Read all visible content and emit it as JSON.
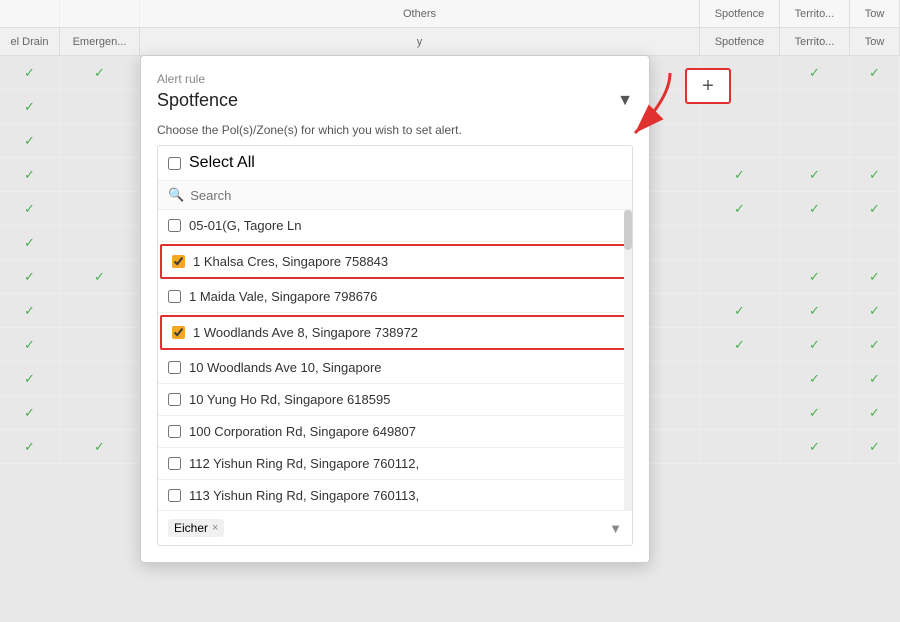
{
  "header": {
    "others_label": "Others",
    "col_spotfence": "Spotfence",
    "col_territo": "Territo...",
    "col_tow": "Tow"
  },
  "subheader": {
    "col_el_drain": "el Drain",
    "col_emergen": "Emergen...",
    "col_y": "y",
    "col_spotfence": "Spotfence",
    "col_territo": "Territo...",
    "col_tow": "Tow"
  },
  "panel": {
    "alert_rule_label": "Alert rule",
    "dropdown_value": "Spotfence",
    "choose_label": "Choose the Pol(s)/Zone(s) for which you wish to set alert.",
    "select_all_label": "Select All",
    "search_placeholder": "Search",
    "list_items": [
      {
        "id": 1,
        "label": "05-01(G, Tagore Ln",
        "checked": false,
        "highlighted": false
      },
      {
        "id": 2,
        "label": "1 Khalsa Cres, Singapore 758843",
        "checked": true,
        "highlighted": true
      },
      {
        "id": 3,
        "label": "1 Maida Vale, Singapore 798676",
        "checked": false,
        "highlighted": false
      },
      {
        "id": 4,
        "label": "1 Woodlands Ave 8, Singapore 738972",
        "checked": true,
        "highlighted": true
      },
      {
        "id": 5,
        "label": "10 Woodlands Ave 10, Singapore",
        "checked": false,
        "highlighted": false
      },
      {
        "id": 6,
        "label": "10 Yung Ho Rd, Singapore 618595",
        "checked": false,
        "highlighted": false
      },
      {
        "id": 7,
        "label": "100 Corporation Rd, Singapore 649807",
        "checked": false,
        "highlighted": false
      },
      {
        "id": 8,
        "label": "112 Yishun Ring Rd, Singapore 760112,",
        "checked": false,
        "highlighted": false
      },
      {
        "id": 9,
        "label": "113 Yishun Ring Rd, Singapore 760113,",
        "checked": false,
        "highlighted": false
      }
    ],
    "footer_tag": "Eicher",
    "footer_tag_close": "×"
  },
  "plus_button": {
    "label": "+"
  },
  "checkmark": "✓",
  "rows": [
    {
      "cells": [
        true,
        true,
        false,
        true,
        true
      ]
    },
    {
      "cells": [
        true,
        false,
        false,
        false,
        false
      ]
    },
    {
      "cells": [
        true,
        false,
        false,
        false,
        false
      ]
    },
    {
      "cells": [
        true,
        false,
        true,
        true,
        true
      ]
    },
    {
      "cells": [
        true,
        false,
        true,
        true,
        true
      ]
    },
    {
      "cells": [
        true,
        false,
        false,
        false,
        false
      ]
    },
    {
      "cells": [
        true,
        true,
        false,
        true,
        true
      ]
    },
    {
      "cells": [
        true,
        false,
        true,
        true,
        true
      ]
    },
    {
      "cells": [
        true,
        false,
        true,
        true,
        true
      ]
    },
    {
      "cells": [
        true,
        false,
        false,
        true,
        true
      ]
    },
    {
      "cells": [
        true,
        false,
        false,
        true,
        true
      ]
    },
    {
      "cells": [
        true,
        true,
        false,
        true,
        true
      ]
    }
  ]
}
